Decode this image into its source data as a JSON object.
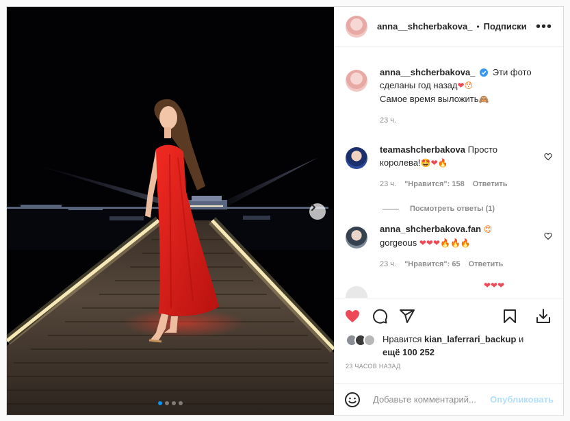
{
  "post": {
    "username": "anna__shcherbakova_",
    "follow_label": "Подписки",
    "more_label": "•••"
  },
  "caption": {
    "username": "anna__shcherbakova_",
    "text_line1": "Эти фото",
    "text_line2": "сделаны год назад",
    "text_line3": "Самое время выложить",
    "time": "23 ч."
  },
  "comments": [
    {
      "username": "teamashcherbakova",
      "text_line1": "Просто",
      "text_line2": "королева!",
      "time": "23 ч.",
      "likes": "\"Нравится\": 158",
      "reply": "Ответить",
      "view_replies": "Посмотреть ответы (1)"
    },
    {
      "username": "anna_shcherbakova.fan",
      "text_line2": "gorgeous",
      "time": "23 ч.",
      "likes": "\"Нравится\": 65",
      "reply": "Ответить"
    }
  ],
  "likes": {
    "prefix": "Нравится",
    "user": "kian_laferrari_backup",
    "and": "и",
    "more": "ещё 100 252"
  },
  "timestamp": "23 ЧАСОВ НАЗАД",
  "add_comment": {
    "placeholder": "Добавьте комментарий...",
    "publish": "Опубликовать"
  },
  "carousel": {
    "total": 4,
    "active": 0
  },
  "colors": {
    "accent": "#0095f6",
    "liked": "#ed4956",
    "dress": "#e0201e"
  },
  "icons": [
    "heart-icon",
    "comment-icon",
    "share-icon",
    "bookmark-icon",
    "download-icon",
    "emoji-icon",
    "verified-icon",
    "chevron-right-icon"
  ]
}
